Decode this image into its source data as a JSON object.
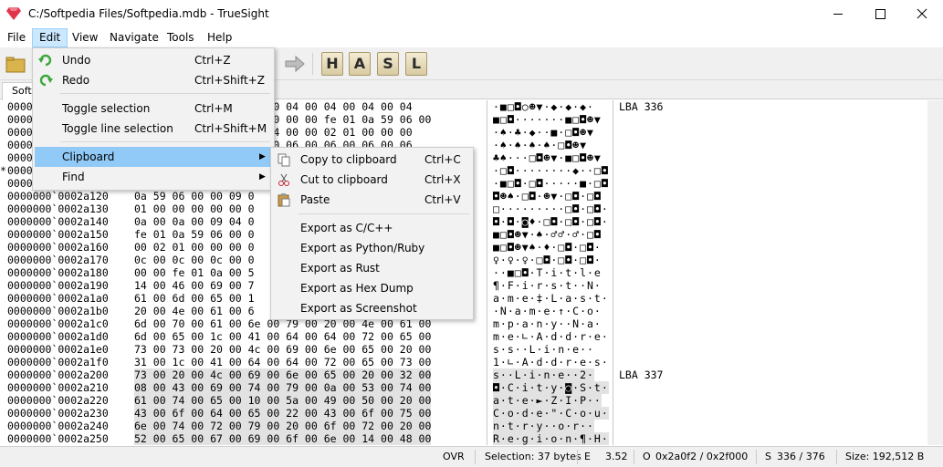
{
  "window": {
    "title": "C:/Softpedia Files/Softpedia.mdb - TrueSight",
    "minimize_glyph": "—",
    "maximize_glyph": "☐",
    "close_glyph": "✕"
  },
  "menubar": [
    "File",
    "Edit",
    "View",
    "Navigate",
    "Tools",
    "Help"
  ],
  "toolbar": {
    "letters": [
      "H",
      "A",
      "S",
      "L"
    ]
  },
  "tab": {
    "label": "Softp"
  },
  "editor": {
    "rows": [
      {
        "addr": "0000",
        "hex": "                  00 00 04 00 04 00 04 00 04",
        "asc": "·■□◘○☻▼·◆·◆·◆·",
        "lba": "LBA 336",
        "sel": false
      },
      {
        "addr": "0000",
        "hex": "                  00 00 00 00 fe 01 0a 59 06 00",
        "asc": "■□◘·······■□◘☻▼",
        "lba": "",
        "sel": false
      },
      {
        "addr": "0000",
        "hex": "                  09 04 00 00 02 01 00 00 00",
        "asc": "·♠·♣·◆··■·□◘☻▼",
        "lba": "",
        "sel": false
      },
      {
        "addr": "0000",
        "hex": "                  06 00 06 00 06 00 06 00 06",
        "asc": "·♠·♠·♠·♠·□◘☻▼",
        "lba": "",
        "sel": false
      },
      {
        "addr": "0000",
        "hex": "",
        "asc": "♣♠···□◘☻▼·■□◘☻▼",
        "lba": "",
        "sel": false
      },
      {
        "addr": "0000",
        "hex": "",
        "asc": "·□◘········◆··□◘",
        "lba": "",
        "sel": false,
        "mark": "*"
      },
      {
        "addr": "0000",
        "hex": "",
        "asc": "·■□◘·□◘·····■·□◘",
        "lba": "",
        "sel": false
      },
      {
        "addr": "0000000`0002a120",
        "hex": "0a 59 06 00 00 09 0",
        "asc": "◘☻♠·□◘·☻▼·□◘·□◘",
        "lba": "",
        "sel": false
      },
      {
        "addr": "0000000`0002a130",
        "hex": "01 00 00 00 00 00 0",
        "asc": "□·········□◘·□◘·",
        "lba": "",
        "sel": false
      },
      {
        "addr": "0000000`0002a140",
        "hex": "0a 00 0a 00 09 04 0",
        "asc": "◘·◘·◙♦·□◘·□◘·□◘·",
        "lba": "",
        "sel": false
      },
      {
        "addr": "0000000`0002a150",
        "hex": "fe 01 0a 59 06 00 0",
        "asc": "■□◘☻▼·♠·♂♂·♂·□◘",
        "lba": "",
        "sel": false
      },
      {
        "addr": "0000000`0002a160",
        "hex": "00 02 01 00 00 00 0",
        "asc": "■□◘☻▼♠·♦·□◘·□◘·",
        "lba": "",
        "sel": false
      },
      {
        "addr": "0000000`0002a170",
        "hex": "0c 00 0c 00 0c 00 0",
        "asc": "♀·♀·♀·□◘·□◘·□◘·",
        "lba": "",
        "sel": false
      },
      {
        "addr": "0000000`0002a180",
        "hex": "00 00 fe 01 0a 00 5",
        "asc": "··■□◘·T·i·t·l·e",
        "lba": "",
        "sel": false
      },
      {
        "addr": "0000000`0002a190",
        "hex": "14 00 46 00 69 00 7",
        "asc": "¶·F·i·r·s·t··N·",
        "lba": "",
        "sel": false
      },
      {
        "addr": "0000000`0002a1a0",
        "hex": "61 00 6d 00 65 00 1",
        "asc": "a·m·e·‡·L·a·s·t·",
        "lba": "",
        "sel": false
      },
      {
        "addr": "0000000`0002a1b0",
        "hex": "20 00 4e 00 61 00 6",
        "asc": "·N·a·m·e·↑·C·o·",
        "lba": "",
        "sel": false
      },
      {
        "addr": "0000000`0002a1c0",
        "hex": "6d 00 70 00 61 00 6e 00 79 00 20 00 4e 00 61 00",
        "asc": "m·p·a·n·y··N·a·",
        "lba": "",
        "sel": false
      },
      {
        "addr": "0000000`0002a1d0",
        "hex": "6d 00 65 00 1c 00 41 00 64 00 64 00 72 00 65 00",
        "asc": "m·e·∟·A·d·d·r·e·",
        "lba": "",
        "sel": false
      },
      {
        "addr": "0000000`0002a1e0",
        "hex": "73 00 73 00 20 00 4c 00 69 00 6e 00 65 00 20 00",
        "asc": "s·s··L·i·n·e··",
        "lba": "",
        "sel": false
      },
      {
        "addr": "0000000`0002a1f0",
        "hex": "31 00 1c 00 41 00 64 00 64 00 72 00 65 00 73 00",
        "asc": "1·∟·A·d·d·r·e·s·",
        "lba": "",
        "sel": false
      },
      {
        "addr": "0000000`0002a200",
        "hex": "73 00 20 00 4c 00 69 00 6e 00 65 00 20 00 32 00",
        "asc": "s··L·i·n·e··2·",
        "lba": "LBA 337",
        "sel": true
      },
      {
        "addr": "0000000`0002a210",
        "hex": "08 00 43 00 69 00 74 00 79 00 0a 00 53 00 74 00",
        "asc": "◘·C·i·t·y·◙·S·t·",
        "lba": "",
        "sel": true
      },
      {
        "addr": "0000000`0002a220",
        "hex": "61 00 74 00 65 00 10 00 5a 00 49 00 50 00 20 00",
        "asc": "a·t·e·►·Z·I·P··",
        "lba": "",
        "sel": true
      },
      {
        "addr": "0000000`0002a230",
        "hex": "43 00 6f 00 64 00 65 00 22 00 43 00 6f 00 75 00",
        "asc": "C·o·d·e·\"·C·o·u·",
        "lba": "",
        "sel": true
      },
      {
        "addr": "0000000`0002a240",
        "hex": "6e 00 74 00 72 00 79 00 20 00 6f 00 72 00 20 00",
        "asc": "n·t·r·y··o·r··",
        "lba": "",
        "sel": true
      },
      {
        "addr": "0000000`0002a250",
        "hex": "52 00 65 00 67 00 69 00 6f 00 6e 00 14 00 48 00",
        "asc": "R·e·g·i·o·n·¶·H·",
        "lba": "",
        "sel": true
      },
      {
        "addr": "0000000`0002a260",
        "hex": "6f 00 6d 00 65 00 20 00 50 00 68 00 6f 00 6e 00",
        "asc": "o·m·e··P·h·o·n·",
        "lba": "",
        "sel": true
      }
    ]
  },
  "edit_menu": {
    "items": [
      {
        "label": "Undo",
        "shortcut": "Ctrl+Z",
        "icon": "undo-icon"
      },
      {
        "label": "Redo",
        "shortcut": "Ctrl+Shift+Z",
        "icon": "redo-icon"
      },
      {
        "label": "Toggle selection",
        "shortcut": "Ctrl+M"
      },
      {
        "label": "Toggle line selection",
        "shortcut": "Ctrl+Shift+M"
      },
      {
        "label": "Clipboard",
        "shortcut": "",
        "submenu": true,
        "highlight": true
      },
      {
        "label": "Find",
        "shortcut": "",
        "submenu": true
      }
    ]
  },
  "clipboard_menu": {
    "items": [
      {
        "label": "Copy to clipboard",
        "shortcut": "Ctrl+C",
        "icon": "copy-icon"
      },
      {
        "label": "Cut to clipboard",
        "shortcut": "Ctrl+X",
        "icon": "cut-icon"
      },
      {
        "label": "Paste",
        "shortcut": "Ctrl+V",
        "icon": "paste-icon"
      },
      {
        "label": "Export as C/C++",
        "shortcut": ""
      },
      {
        "label": "Export as Python/Ruby",
        "shortcut": ""
      },
      {
        "label": "Export as Rust",
        "shortcut": ""
      },
      {
        "label": "Export as Hex Dump",
        "shortcut": ""
      },
      {
        "label": "Export as Screenshot",
        "shortcut": ""
      }
    ]
  },
  "statusbar": {
    "mode": "OVR",
    "selection": "Selection: 37 bytes",
    "entropy_label": "E",
    "entropy": "3.52",
    "offset_label": "O",
    "offset": "0x2a0f2 / 0x2f000",
    "sector_label": "S",
    "sector": "336 / 376",
    "size": "Size: 192,512 B"
  },
  "colors": {
    "menu_highlight": "#91c9f7",
    "selection_bg": "#e2e2e2",
    "accent": "#cce8ff"
  }
}
